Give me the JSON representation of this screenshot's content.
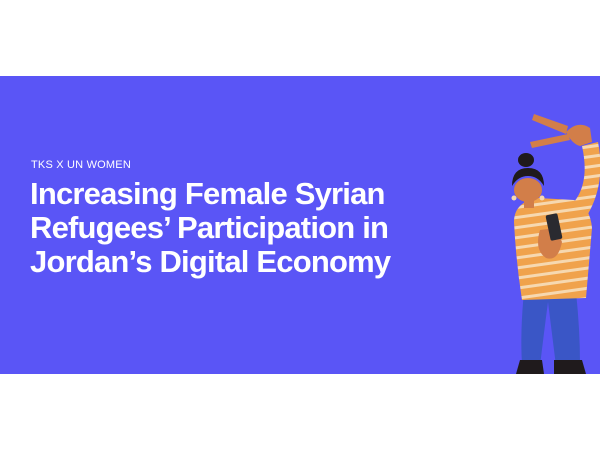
{
  "banner": {
    "background_color": "#5a55f6",
    "eyebrow": "TKS X UN WOMEN",
    "headline_lines": [
      "Increasing Female Syrian",
      "Refugees’ Participation in",
      "Jordan’s Digital Economy"
    ]
  },
  "illustration": {
    "icon": "woman-with-phone-3d-character",
    "colors": {
      "sweater_orange": "#f0a24c",
      "sweater_stripe": "#f6d8b0",
      "pants_blue": "#3a56c6",
      "skin": "#d27e49",
      "hair": "#1f1a1c",
      "phone": "#2a2a30"
    }
  }
}
